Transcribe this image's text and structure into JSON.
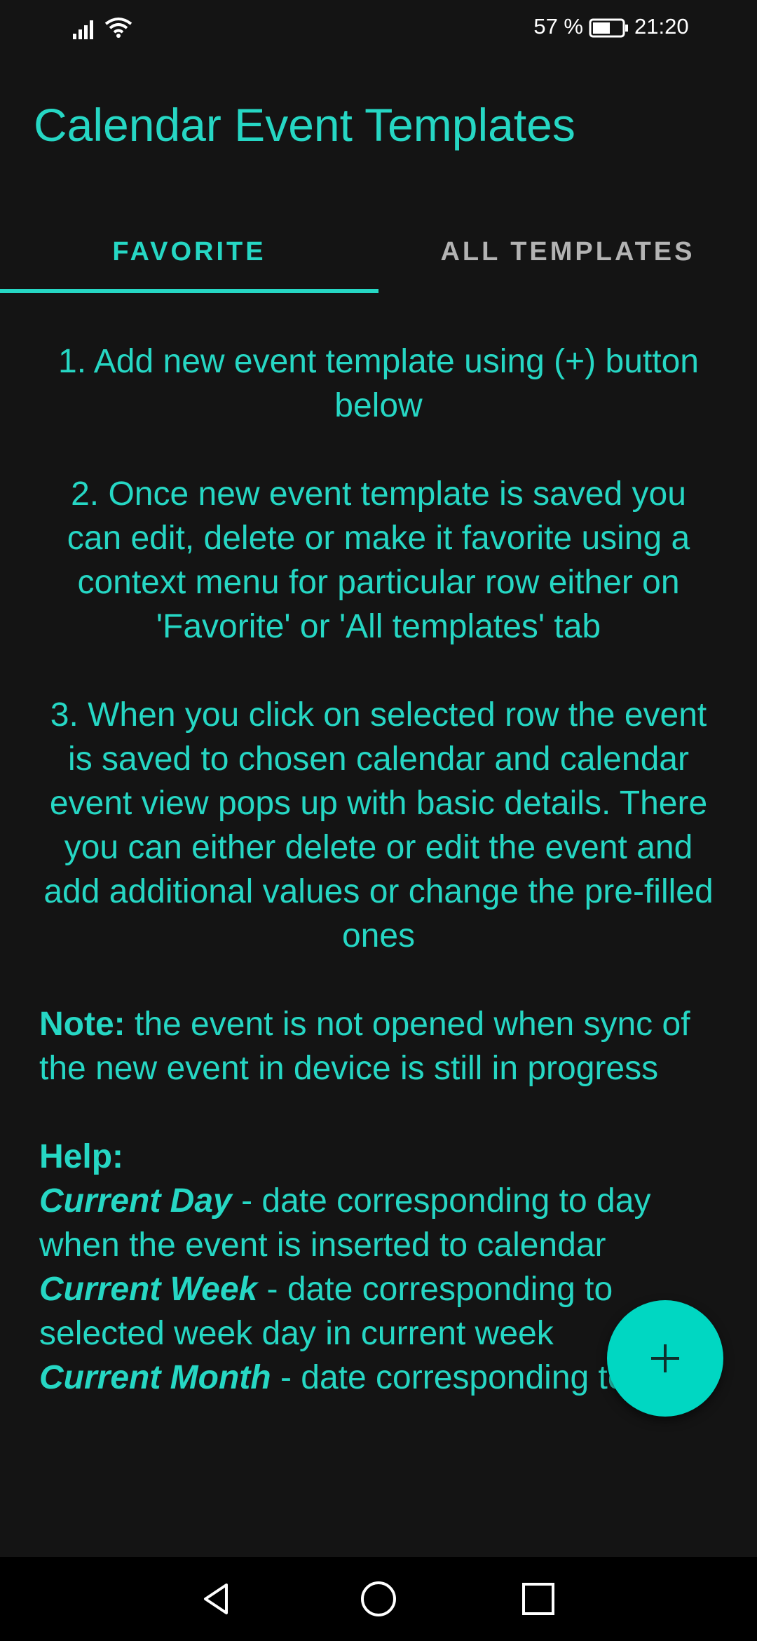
{
  "status_bar": {
    "battery_text": "57 %",
    "time": "21:20",
    "icons": [
      "signal-icon",
      "wifi-icon",
      "battery-icon"
    ]
  },
  "app": {
    "title": "Calendar Event Templates"
  },
  "tabs": [
    {
      "label": "FAVORITE",
      "selected": true
    },
    {
      "label": "ALL TEMPLATES",
      "selected": false
    }
  ],
  "content": {
    "step1": "1. Add new event template using (+) button below",
    "step2": "2. Once new event template is saved you can edit, delete or make it favorite using a context menu for particular row either on 'Favorite' or 'All templates' tab",
    "step3": "3. When you click on selected row the event is saved to chosen calendar and calendar event view pops up with basic details. There you can either delete or edit the event and add additional values or change the pre-filled ones",
    "note_label": "Note:",
    "note_text": " the event is not opened when sync of the new event in device is still in progress",
    "help_label": "Help:",
    "help_items": [
      {
        "term": "Current Day",
        "desc": " - date corresponding to day when the event is inserted to calendar"
      },
      {
        "term": "Current Week",
        "desc": " - date corresponding to selected week day in current week"
      },
      {
        "term": "Current Month",
        "desc": " - date corresponding to"
      }
    ]
  },
  "fab": {
    "icon": "plus-icon"
  },
  "nav_bar": {
    "icons": [
      "back-icon",
      "home-icon",
      "recents-icon"
    ]
  },
  "colors": {
    "background": "#141414",
    "accent": "#26d7c4",
    "fab": "#00d7c2",
    "inactive_tab": "#b3b3b3"
  }
}
